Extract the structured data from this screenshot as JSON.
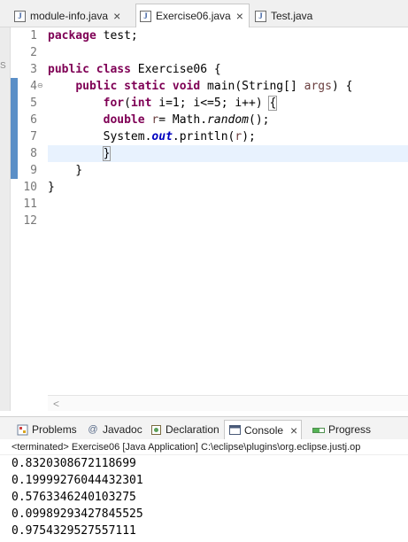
{
  "editor_tabs": [
    {
      "label": "module-info.java",
      "active": false
    },
    {
      "label": "Exercise06.java",
      "active": true
    },
    {
      "label": "Test.java",
      "active": false
    }
  ],
  "side_fragment": "S",
  "line_numbers": [
    "1",
    "2",
    "3",
    "4",
    "5",
    "6",
    "7",
    "8",
    "9",
    "10",
    "11",
    "12"
  ],
  "code": {
    "l1_kw": "package",
    "l1_rest": " test;",
    "l3_kw1": "public",
    "l3_kw2": "class",
    "l3_rest": " Exercise06 {",
    "l4_indent": "    ",
    "l4_kw1": "public",
    "l4_kw2": "static",
    "l4_kw3": "void",
    "l4_mid": " main(String[] ",
    "l4_param": "args",
    "l4_end": ") {",
    "l5_indent": "        ",
    "l5_kw1": "for",
    "l5_p1": "(",
    "l5_kw2": "int",
    "l5_mid": " i=1; i<=5; i++) ",
    "l5_brace": "{",
    "l6_indent": "        ",
    "l6_kw": "double",
    "l6_var": "r",
    "l6_mid": "= Math.",
    "l6_method": "random",
    "l6_end": "();",
    "l7_indent": "        ",
    "l7_a": "System.",
    "l7_field": "out",
    "l7_b": ".println(",
    "l7_var": "r",
    "l7_end": ");",
    "l8_indent": "        ",
    "l8_brace": "}",
    "l9_text": "    }",
    "l10_text": "}"
  },
  "hscroll_arrow": "<",
  "panel_tabs": [
    {
      "label": "Problems",
      "icon": "problems-icon"
    },
    {
      "label": "Javadoc",
      "icon": "javadoc-icon",
      "glyph": "@"
    },
    {
      "label": "Declaration",
      "icon": "declaration-icon"
    },
    {
      "label": "Console",
      "icon": "console-icon",
      "active": true
    },
    {
      "label": "Progress",
      "icon": "progress-icon"
    }
  ],
  "console": {
    "header": "<terminated> Exercise06 [Java Application] C:\\eclipse\\plugins\\org.eclipse.justj.op",
    "output": [
      "0.8320308672118699",
      "0.19999276044432301",
      "0.5763346240103275",
      "0.09989293427845525",
      "0.9754329527557111"
    ]
  },
  "colors": {
    "keyword": "#7f0055",
    "static_ref": "#0000c0",
    "change_bar": "#5b8fc7",
    "current_line": "#e8f2fe"
  }
}
